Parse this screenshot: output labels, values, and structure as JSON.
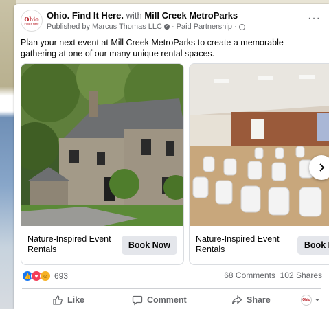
{
  "post": {
    "page_name": "Ohio. Find It Here.",
    "with_text": "with",
    "partner_name": "Mill Creek MetroParks",
    "published_by": "Published by Marcus Thomas LLC",
    "paid_partnership": "· Paid Partnership ·",
    "more_label": "···",
    "logo_text_1": "Ohio",
    "logo_text_2": "Find It Here",
    "body": "Plan your next event at Mill Creek MetroParks to create a memorable gathering at one of our many unique rental spaces."
  },
  "carousel": {
    "slides": [
      {
        "caption": "Nature-Inspired Event Rentals",
        "cta": "Book Now"
      },
      {
        "caption": "Nature-Inspired Event Rentals",
        "cta": "Book Now"
      }
    ]
  },
  "stats": {
    "reaction_count": "693",
    "comments_shares": "68 Comments  102 Shares"
  },
  "actions": {
    "like": "Like",
    "comment": "Comment",
    "share": "Share"
  },
  "icons": [
    "like-reaction-icon",
    "love-reaction-icon",
    "haha-reaction-icon",
    "chevron-right-icon",
    "thumbs-up-icon",
    "comment-icon",
    "share-icon",
    "chevron-down-icon",
    "verified-icon",
    "globe-icon"
  ],
  "colors": {
    "like_blue": "#1877f2",
    "love_red": "#f33e58",
    "haha_yellow": "#f7b125",
    "brand_red": "#b5121b",
    "muted": "#65676b"
  }
}
